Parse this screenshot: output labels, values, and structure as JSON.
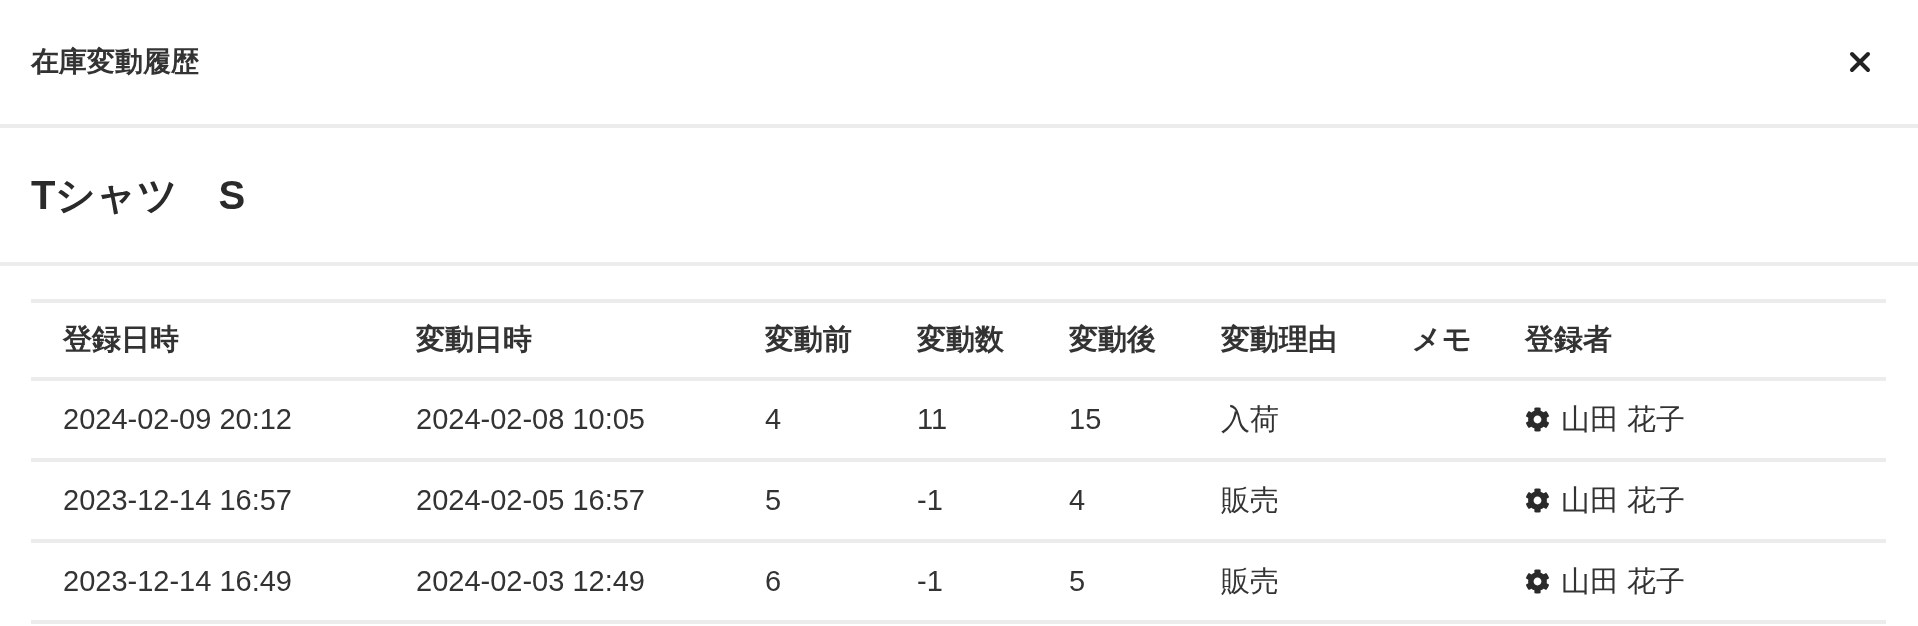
{
  "modal": {
    "title": "在庫変動履歴"
  },
  "product": {
    "name": "Tシャツ　S"
  },
  "table": {
    "columns": [
      "登録日時",
      "変動日時",
      "変動前",
      "変動数",
      "変動後",
      "変動理由",
      "メモ",
      "登録者"
    ],
    "rows": [
      {
        "registered_at": "2024-02-09 20:12",
        "changed_at": "2024-02-08 10:05",
        "before": "4",
        "change": "11",
        "after": "15",
        "reason": "入荷",
        "registrant": "山田 花子"
      },
      {
        "registered_at": "2023-12-14 16:57",
        "changed_at": "2024-02-05 16:57",
        "before": "5",
        "change": "-1",
        "after": "4",
        "reason": "販売",
        "registrant": "山田 花子"
      },
      {
        "registered_at": "2023-12-14 16:49",
        "changed_at": "2024-02-03 12:49",
        "before": "6",
        "change": "-1",
        "after": "5",
        "reason": "販売",
        "registrant": "山田 花子"
      }
    ]
  }
}
